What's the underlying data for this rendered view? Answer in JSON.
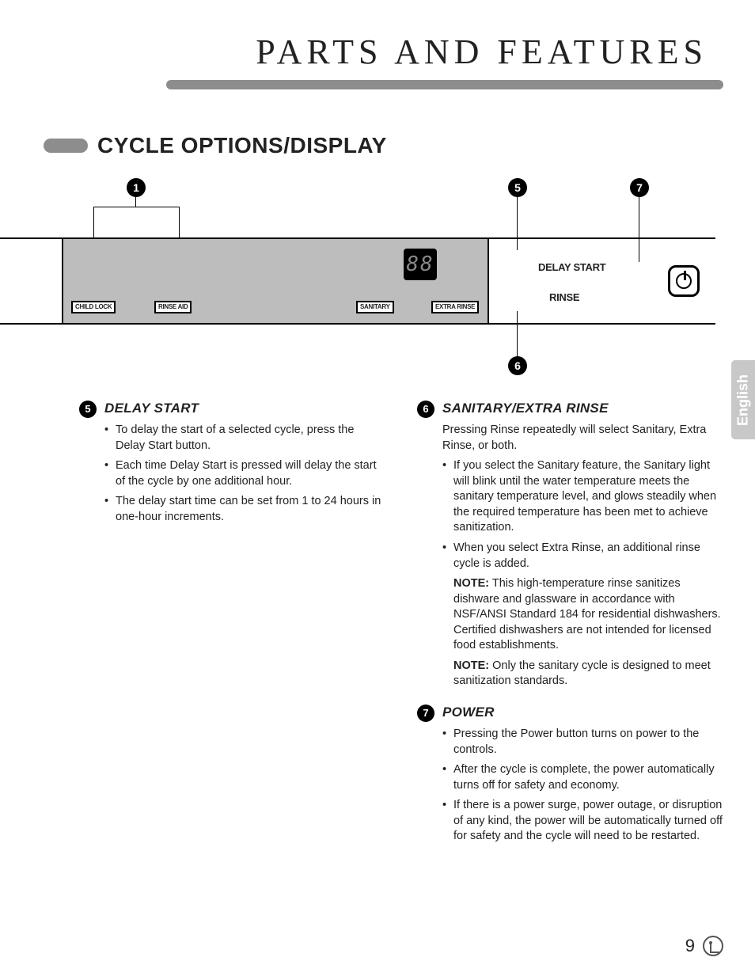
{
  "page_title": "PARTS AND FEATURES",
  "section_heading": "CYCLE OPTIONS/DISPLAY",
  "diagram": {
    "callouts": {
      "c1": "1",
      "c5": "5",
      "c6": "6",
      "c7": "7"
    },
    "indicators": {
      "child_lock": "CHILD LOCK",
      "rinse_aid": "RINSE AID",
      "sanitary": "SANITARY",
      "extra_rinse": "EXTRA RINSE"
    },
    "display": "88",
    "buttons": {
      "delay_start": "DELAY START",
      "rinse": "RINSE"
    }
  },
  "features": {
    "f5": {
      "num": "5",
      "title": "DELAY START",
      "bullets": [
        "To delay the start of a selected cycle, press the Delay Start button.",
        "Each time Delay Start is pressed will delay the start of the cycle by one additional hour.",
        "The delay start time can be set from 1 to 24 hours in one-hour increments."
      ]
    },
    "f6": {
      "num": "6",
      "title": "SANITARY/EXTRA RINSE",
      "intro": "Pressing Rinse repeatedly will select Sanitary, Extra Rinse, or both.",
      "bullets": [
        "If you select the Sanitary feature, the Sanitary light will blink until the water temperature meets the sanitary temperature level, and glows steadily when the required temperature has been met to achieve sanitization.",
        "When you select Extra Rinse, an additional rinse cycle is added."
      ],
      "notes": [
        {
          "label": "NOTE:",
          "text": " This high-temperature rinse sanitizes dishware and glassware in accordance with NSF/ANSI Standard 184 for residential dishwashers. Certified dishwashers are not intended for licensed food establishments."
        },
        {
          "label": "NOTE:",
          "text": " Only the sanitary cycle is designed to meet sanitization standards."
        }
      ]
    },
    "f7": {
      "num": "7",
      "title": "POWER",
      "bullets": [
        "Pressing the Power button turns on power to the controls.",
        "After the cycle is complete, the power automatically turns off for safety and economy.",
        "If there is a power surge, power outage, or disruption of any kind, the power will be automatically turned off for safety and the cycle will need to be restarted."
      ]
    }
  },
  "lang_tab": "English",
  "page_number": "9"
}
